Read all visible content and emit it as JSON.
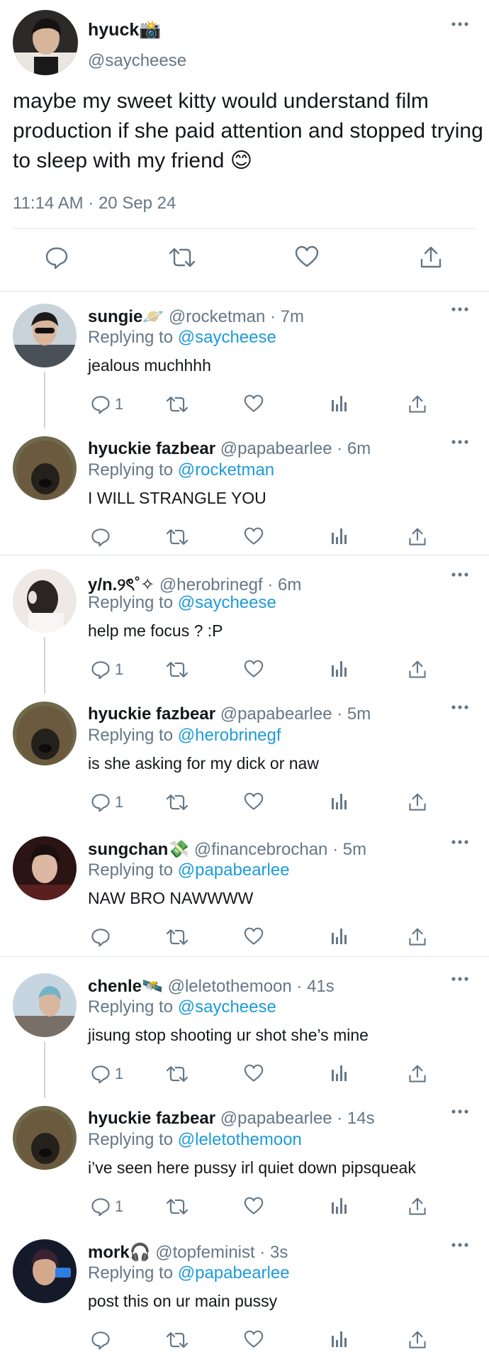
{
  "main_tweet": {
    "display_name": "hyuck📸",
    "handle": "@saycheese",
    "text": "maybe my sweet kitty would understand film production if she paid attention and stopped trying to sleep with my friend 😊",
    "timestamp": "11:14 AM · 20 Sep 24"
  },
  "replying_label": "Replying to",
  "replies": [
    {
      "name": "sungie🪐",
      "handle": "@rocketman",
      "time": "· 7m",
      "replying_to": "@saycheese",
      "text": "jealous muchhhh",
      "reply_count": "1"
    },
    {
      "name": "hyuckie fazbear",
      "handle": "@papabearlee",
      "time": "· 6m",
      "replying_to": "@rocketman",
      "text": "I WILL STRANGLE YOU",
      "reply_count": ""
    },
    {
      "name": "y/n.୨ৎ˚✧",
      "handle": "@herobrinegf",
      "time": "· 6m",
      "replying_to": "@saycheese",
      "text": "help me focus ? :P",
      "reply_count": "1"
    },
    {
      "name": "hyuckie fazbear",
      "handle": "@papabearlee",
      "time": "· 5m",
      "replying_to": "@herobrinegf",
      "text": "is she asking for my dick or naw",
      "reply_count": "1"
    },
    {
      "name": "sungchan💸",
      "handle": "@financebrochan",
      "time": "· 5m",
      "replying_to": "@papabearlee",
      "text": "NAW BRO NAWWWW",
      "reply_count": ""
    },
    {
      "name": "chenle🛰️",
      "handle": "@leletothemoon",
      "time": "· 41s",
      "replying_to": "@saycheese",
      "text": "jisung stop shooting ur shot she’s mine",
      "reply_count": "1"
    },
    {
      "name": "hyuckie fazbear",
      "handle": "@papabearlee",
      "time": "· 14s",
      "replying_to": "@leletothemoon",
      "text": "i’ve seen here pussy irl quiet down pipsqueak",
      "reply_count": "1"
    },
    {
      "name": "mork🎧",
      "handle": "@topfeminist",
      "time": "· 3s",
      "replying_to": "@papabearlee",
      "text": "post this on ur main pussy",
      "reply_count": ""
    }
  ],
  "icons": {
    "reply": "speech-bubble-icon",
    "retweet": "retweet-arrows-icon",
    "like": "heart-icon",
    "views": "bar-chart-icon",
    "share": "share-upload-icon",
    "more": "three-dots-icon"
  },
  "colors": {
    "link": "#1d9bd8",
    "secondary_text": "#657786",
    "primary_text": "#14171a",
    "divider": "#e1e8ed"
  }
}
